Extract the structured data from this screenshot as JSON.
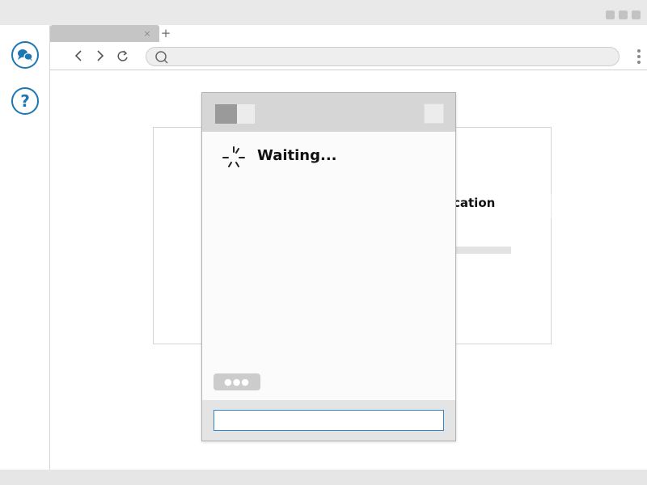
{
  "browser": {
    "tab": {
      "close_glyph": "×",
      "new_tab_glyph": "+"
    },
    "nav": {
      "back_glyph": "‹",
      "forward_glyph": "›",
      "reload_glyph": "↻",
      "address_value": "",
      "address_placeholder": ""
    }
  },
  "sidebar": {
    "chat_icon": "chat-bubbles-icon",
    "help_icon": "help-icon"
  },
  "page": {
    "card_title_fragment": "cation"
  },
  "dialog": {
    "status_text": "Waiting...",
    "spinner_icon": "spinner-icon",
    "typing_indicator": "●●●",
    "input_value": "",
    "input_placeholder": ""
  },
  "colors": {
    "accent_blue": "#1d77b3",
    "input_border": "#2f86c8",
    "chrome_gray": "#e9e9e9"
  }
}
